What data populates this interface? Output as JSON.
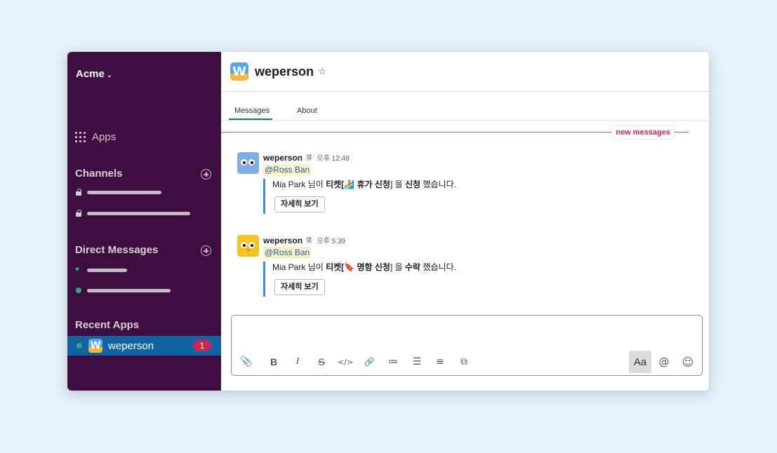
{
  "sidebar": {
    "workspace": "Acme",
    "apps_label": "Apps",
    "channels_title": "Channels",
    "dm_title": "Direct Messages",
    "recent_apps_title": "Recent Apps",
    "active_app": {
      "name": "weperson",
      "badge": "1",
      "logo_letter": "W"
    }
  },
  "channel": {
    "title": "weperson",
    "logo_letter": "W",
    "star_icon": "☆",
    "tabs": [
      "Messages",
      "About"
    ],
    "new_messages_label": "new messages"
  },
  "messages": [
    {
      "sender": "weperson",
      "app_tag": "앱",
      "time": "오후 12:48",
      "mention": "@Ross Ban",
      "text_user": "Mia Park",
      "text_part1": " 님이 ",
      "text_ticket": "티켓[",
      "emoji": "🏄",
      "text_title": " 휴가 신청",
      "text_part2": "] 을 ",
      "text_action": "신청",
      "text_end": " 했습니다.",
      "button": "자세히 보기"
    },
    {
      "sender": "weperson",
      "app_tag": "앱",
      "time": "오후 5:39",
      "mention": "@Ross Ban",
      "text_user": "Mia Park",
      "text_part1": " 님이 ",
      "text_ticket": "티켓[",
      "emoji": "🔖",
      "text_title": " 명함 신청",
      "text_part2": "] 을 ",
      "text_action": "수락",
      "text_end": " 했습니다.",
      "button": "자세히 보기"
    }
  ],
  "composer": {
    "placeholder": "",
    "toolbar": {
      "attach": "📎",
      "bold": "B",
      "italic": "I",
      "strike": "S",
      "code": "</>",
      "link": "🔗",
      "ordered_list": "≔",
      "bullet_list": "☰",
      "blockquote": "≡",
      "code_block": "⧉",
      "format": "Aa",
      "mention": "@",
      "emoji": "☺"
    }
  }
}
